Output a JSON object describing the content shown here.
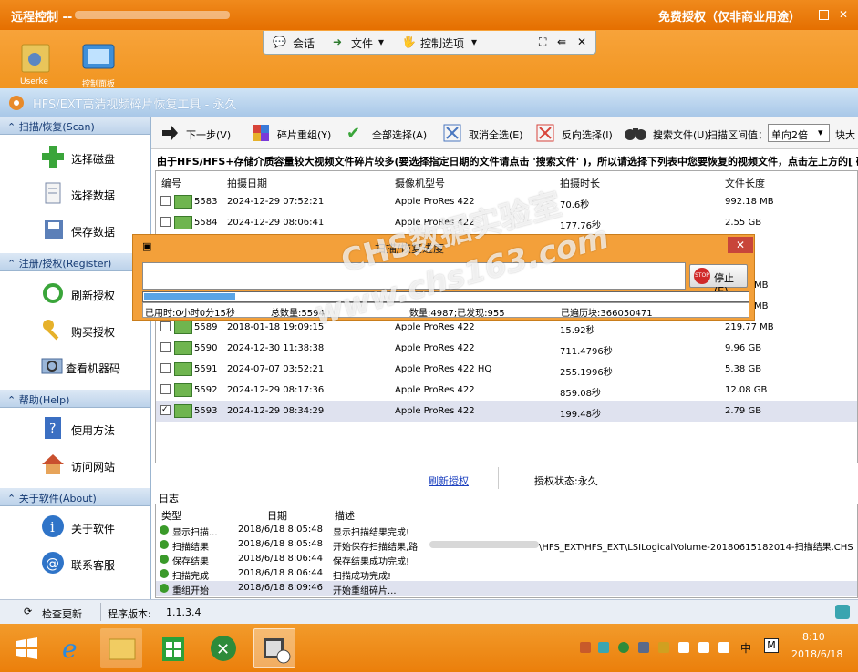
{
  "remote": {
    "title": "远程控制 --",
    "license": "免费授权（仅非商业用途）",
    "toolbar": {
      "chat": "会话",
      "file": "文件",
      "control": "控制选项"
    }
  },
  "desktop": {
    "icon1": "Userke",
    "icon2": "控制面板"
  },
  "app": {
    "title": "HFS/EXT高清视频碎片恢复工具 - 永久"
  },
  "sidebar": {
    "scan_header": "扫描/恢复(Scan)",
    "scan_items": [
      "选择磁盘",
      "选择数据",
      "保存数据"
    ],
    "reg_header": "注册/授权(Register)",
    "reg_items": [
      "刷新授权",
      "购买授权",
      "查看机器码"
    ],
    "help_header": "帮助(Help)",
    "help_items": [
      "使用方法",
      "访问网站"
    ],
    "about_header": "关于软件(About)",
    "about_items": [
      "关于软件",
      "联系客服"
    ]
  },
  "toolbar": {
    "next": "下一步(V)",
    "rebuild": "碎片重组(Y)",
    "select_all": "全部选择(A)",
    "deselect": "取消全选(E)",
    "invert": "反向选择(I)",
    "search": "搜索文件(U)",
    "threshold_label": "扫描区间值：",
    "threshold_value": "单向2倍",
    "block": "块大"
  },
  "notice": "由于HFS/HFS+存储介质容量较大视频文件碎片较多(要选择指定日期的文件请点击 '搜索文件' )，所以请选择下列表中您要恢复的视频文件，点击左上方的[ 碎片",
  "grid": {
    "headers": [
      "编号",
      "拍摄日期",
      "摄像机型号",
      "拍摄时长",
      "文件长度"
    ],
    "rows": [
      {
        "id": "5583",
        "date": "2024-12-29 07:52:21",
        "model": "Apple ProRes 422",
        "dur": "70.6秒",
        "size": "992.18 MB",
        "checked": false
      },
      {
        "id": "5584",
        "date": "2024-12-29 08:06:41",
        "model": "Apple ProRes 422",
        "dur": "177.76秒",
        "size": "2.55 GB",
        "checked": false
      },
      {
        "id": "5589",
        "date": "2018-01-18 19:09:15",
        "model": "Apple ProRes 422",
        "dur": "15.92秒",
        "size": "219.77 MB",
        "checked": false
      },
      {
        "id": "5590",
        "date": "2024-12-30 11:38:38",
        "model": "Apple ProRes 422",
        "dur": "711.4796秒",
        "size": "9.96 GB",
        "checked": false
      },
      {
        "id": "5591",
        "date": "2024-07-07 03:52:21",
        "model": "Apple ProRes 422 HQ",
        "dur": "255.1996秒",
        "size": "5.38 GB",
        "checked": false
      },
      {
        "id": "5592",
        "date": "2024-12-29 08:17:36",
        "model": "Apple ProRes 422",
        "dur": "859.08秒",
        "size": "12.08 GB",
        "checked": false
      },
      {
        "id": "5593",
        "date": "2024-12-29 08:34:29",
        "model": "Apple ProRes 422",
        "dur": "199.48秒",
        "size": "2.79 GB",
        "checked": true
      }
    ],
    "hidden_sizes": [
      "MB",
      "MB"
    ]
  },
  "auth": {
    "refresh": "刷新授权",
    "status": "授权状态:永久"
  },
  "log": {
    "title": "日志",
    "headers": [
      "类型",
      "日期",
      "描述"
    ],
    "rows": [
      {
        "type": "显示扫描...",
        "date": "2018/6/18 8:05:48",
        "desc": "显示扫描结果完成!"
      },
      {
        "type": "扫描结果",
        "date": "2018/6/18 8:05:48",
        "desc": "开始保存扫描结果,路",
        "desc2": "\\HFS_EXT\\HFS_EXT\\LSILogicalVolume-20180615182014-扫描结果.CHS"
      },
      {
        "type": "保存结果",
        "date": "2018/6/18 8:06:44",
        "desc": "保存结果成功完成!"
      },
      {
        "type": "扫描完成",
        "date": "2018/6/18 8:06:44",
        "desc": "扫描成功完成!"
      },
      {
        "type": "重组开始",
        "date": "2018/6/18 8:09:46",
        "desc": "开始重组碎片..."
      }
    ]
  },
  "status": {
    "check_update": "检查更新",
    "version_label": "程序版本:",
    "version": "1.1.3.4"
  },
  "dialog": {
    "title": "扫描/恢复进度",
    "stop": "停止(E)",
    "progress": 0.15,
    "elapsed": "已用时:0小时0分15秒",
    "total": "总数量:5594",
    "mid": "数量:4987;已发现:955",
    "traversed": "已遍历块:366050471"
  },
  "watermark": {
    "line1": "CHS数据实验室",
    "line2": "www.chs163.com"
  },
  "taskbar": {
    "time": "8:10",
    "date": "2018/6/18",
    "ime": "中",
    "ime2": "M"
  },
  "colors": {
    "orange": "#f19520",
    "blue": "#a9c8e8",
    "selected": "#dfe2ef"
  }
}
